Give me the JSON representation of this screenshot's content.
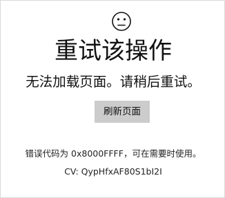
{
  "error_page": {
    "icon": "sad-face-icon",
    "title": "重试该操作",
    "message": "无法加载页面。请稍后重试。",
    "retry_button_label": "刷新页面",
    "error_code_line": "错误代码为 0x8000FFFF，可在需要时使用。",
    "cv_line": "CV: QypHfxAF80S1bI2I"
  }
}
